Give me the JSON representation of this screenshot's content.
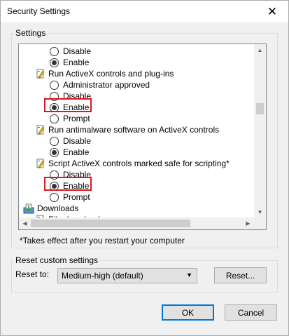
{
  "window": {
    "title": "Security Settings",
    "close_glyph": "✕"
  },
  "settings_group": {
    "label": "Settings",
    "items": [
      {
        "kind": "radio",
        "label": "Disable",
        "checked": false
      },
      {
        "kind": "radio",
        "label": "Enable",
        "checked": true
      },
      {
        "kind": "category",
        "label": "Run ActiveX controls and plug-ins",
        "icon": "settings-pen-icon"
      },
      {
        "kind": "radio",
        "label": "Administrator approved",
        "checked": false
      },
      {
        "kind": "radio",
        "label": "Disable",
        "checked": false
      },
      {
        "kind": "radio",
        "label": "Enable",
        "checked": true,
        "highlighted": true
      },
      {
        "kind": "radio",
        "label": "Prompt",
        "checked": false
      },
      {
        "kind": "category",
        "label": "Run antimalware software on ActiveX controls",
        "icon": "settings-pen-icon"
      },
      {
        "kind": "radio",
        "label": "Disable",
        "checked": false
      },
      {
        "kind": "radio",
        "label": "Enable",
        "checked": true
      },
      {
        "kind": "category",
        "label": "Script ActiveX controls marked safe for scripting*",
        "icon": "settings-pen-icon"
      },
      {
        "kind": "radio",
        "label": "Disable",
        "checked": false
      },
      {
        "kind": "radio",
        "label": "Enable",
        "checked": true,
        "highlighted": true
      },
      {
        "kind": "radio",
        "label": "Prompt",
        "checked": false
      },
      {
        "kind": "category",
        "label": "Downloads",
        "icon": "downloads-icon"
      },
      {
        "kind": "category",
        "label": "File download",
        "icon": "settings-pen-icon"
      }
    ],
    "footnote": "*Takes effect after you restart your computer"
  },
  "reset_group": {
    "label": "Reset custom settings",
    "reset_to_label": "Reset to:",
    "selected_level": "Medium-high (default)",
    "reset_button": "Reset..."
  },
  "buttons": {
    "ok": "OK",
    "cancel": "Cancel"
  },
  "colors": {
    "highlight": "#e0161c",
    "accent": "#0078d7"
  }
}
